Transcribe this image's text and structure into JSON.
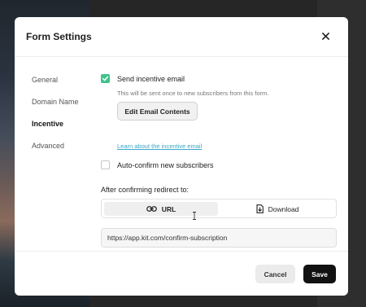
{
  "modal": {
    "title": "Form Settings",
    "close_icon": "close-icon"
  },
  "sidebar": {
    "items": [
      {
        "label": "General",
        "active": false
      },
      {
        "label": "Domain Name",
        "active": false
      },
      {
        "label": "Incentive",
        "active": true
      },
      {
        "label": "Advanced",
        "active": false
      }
    ]
  },
  "incentive": {
    "send_email": {
      "checked": true,
      "label": "Send incentive email",
      "hint": "This will be sent once to new subscribers from this form."
    },
    "edit_button_label": "Edit Email Contents",
    "learn_link": "Learn about the incentive email",
    "auto_confirm": {
      "checked": false,
      "label": "Auto-confirm new subscribers"
    },
    "redirect": {
      "label": "After confirming redirect to:",
      "options": [
        {
          "label": "URL",
          "icon": "link-icon",
          "active": true
        },
        {
          "label": "Download",
          "icon": "download-file-icon",
          "active": false
        }
      ],
      "url_value": "https://app.kit.com/confirm-subscription"
    }
  },
  "footer": {
    "cancel_label": "Cancel",
    "save_label": "Save"
  },
  "colors": {
    "checkbox_checked": "#3ec38b",
    "link": "#3aa7c7",
    "save_button": "#111111"
  }
}
